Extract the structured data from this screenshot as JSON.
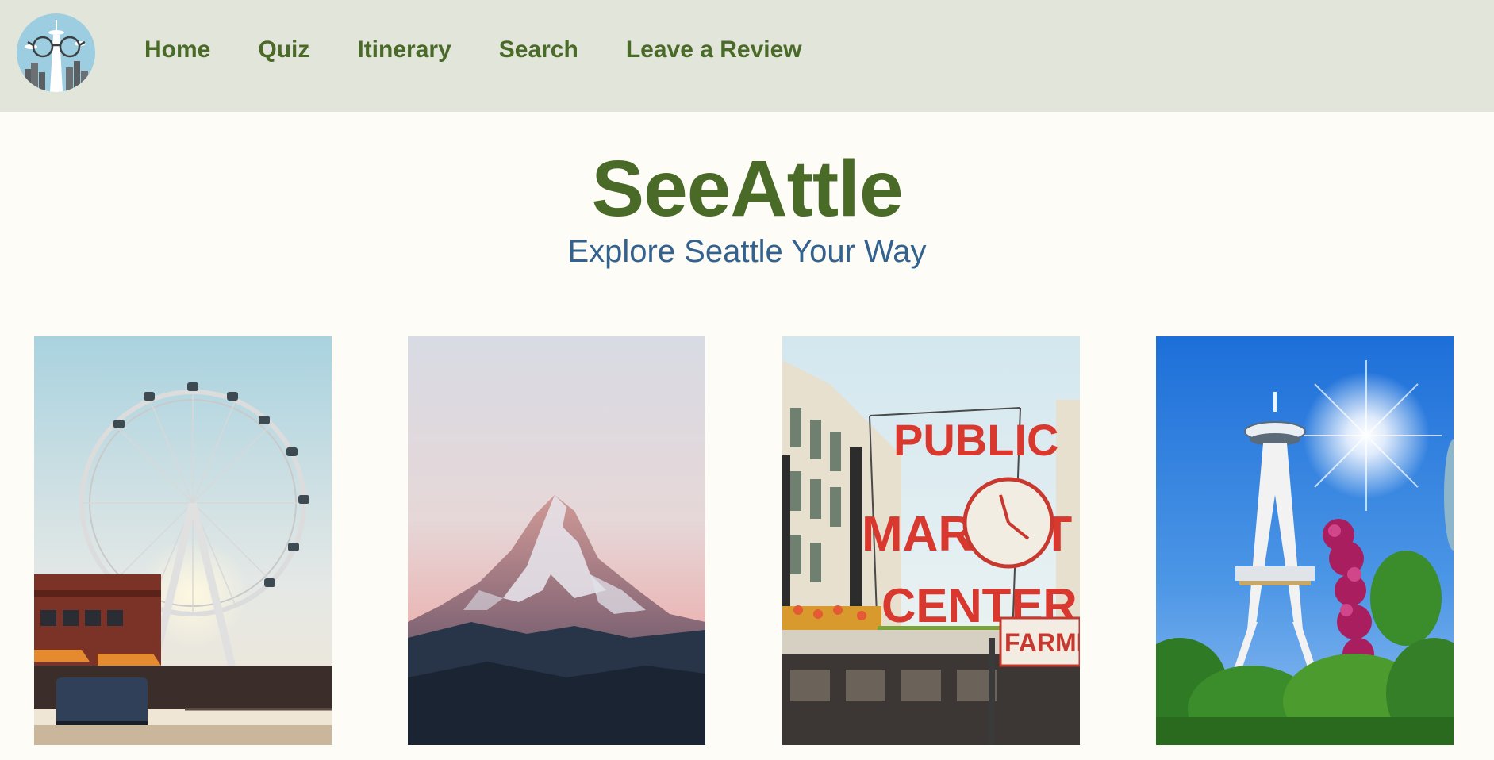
{
  "nav": {
    "logo_alt": "SeeAttle logo",
    "links": [
      {
        "label": "Home"
      },
      {
        "label": "Quiz"
      },
      {
        "label": "Itinerary"
      },
      {
        "label": "Search"
      },
      {
        "label": "Leave a Review"
      }
    ]
  },
  "hero": {
    "title": "SeeAttle",
    "subtitle": "Explore Seattle Your Way"
  },
  "gallery": {
    "images": [
      {
        "subject": "ferris-wheel-waterfront"
      },
      {
        "subject": "mountain-peak"
      },
      {
        "subject": "public-market-sign"
      },
      {
        "subject": "space-needle"
      }
    ],
    "sign_text": {
      "line1": "PUBLIC",
      "line2": "MARKET",
      "line3": "CENTER",
      "farmers": "FARMERS"
    }
  },
  "colors": {
    "nav_bg": "#e2e5da",
    "page_bg": "#fdfcf7",
    "accent_green": "#4a6a28",
    "subtitle_blue": "#34628e"
  }
}
